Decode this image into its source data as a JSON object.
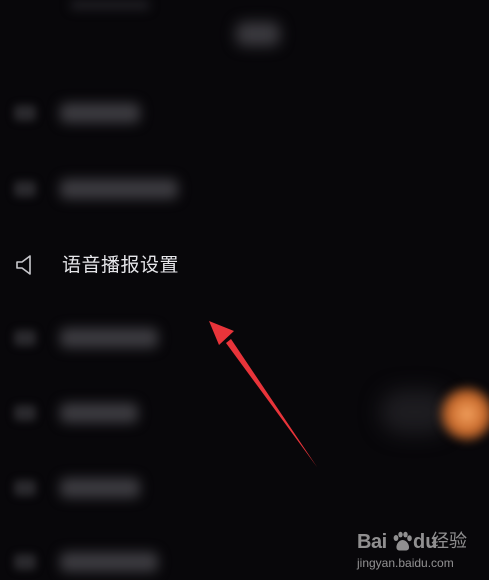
{
  "screen": {
    "background": "#08070a"
  },
  "menu": {
    "focused_item": {
      "label": "语音播报设置",
      "icon": "speaker-icon"
    }
  },
  "annotation": {
    "arrow_color": "#e8343a",
    "arrow_icon": "red-arrow-icon"
  },
  "watermark": {
    "brand_prefix": "Bai",
    "brand_suffix": "du",
    "brand_name": "经验",
    "url": "jingyan.baidu.com"
  }
}
